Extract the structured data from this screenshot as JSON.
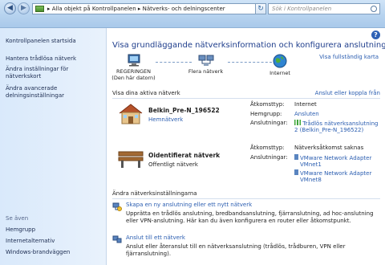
{
  "address": {
    "breadcrumb_root": "Alla objekt på Kontrollpanelen",
    "breadcrumb_current": "Nätverks- och delningscenter",
    "separator": "▸",
    "search_placeholder": "Sök i Kontrollpanelen"
  },
  "sidebar": {
    "items": [
      {
        "label": "Kontrollpanelen startsida"
      },
      {
        "label": "Hantera trådlösa nätverk"
      },
      {
        "label": "Ändra inställningar för nätverkskort"
      },
      {
        "label": "Ändra avancerade delningsinställningar"
      }
    ],
    "see_also_label": "Se även",
    "see_also": [
      {
        "label": "Hemgrupp"
      },
      {
        "label": "Internetalternativ"
      },
      {
        "label": "Windows-brandväggen"
      }
    ]
  },
  "main": {
    "title": "Visa grundläggande nätverksinformation och konfigurera anslutningar",
    "full_map_link": "Visa fullständig karta",
    "map": {
      "computer": "REGERINGEN",
      "computer_sub": "(Den här datorn)",
      "networks": "Flera nätverk",
      "internet": "Internet"
    },
    "active_networks_heading": "Visa dina aktiva nätverk",
    "connect_link": "Anslut eller koppla från",
    "networks": [
      {
        "name": "Belkin_Pre-N_196522",
        "type_link": "Hemnätverk",
        "access_label": "Åtkomsttyp:",
        "access_value": "Internet",
        "homegroup_label": "Hemgrupp:",
        "homegroup_value": "Ansluten",
        "connections_label": "Anslutningar:",
        "connections_value_line1": "Trådlös nätverksanslutning",
        "connections_value_line2": "2 (Belkin_Pre-N_196522)"
      },
      {
        "name": "Oidentifierat nätverk",
        "type_text": "Offentligt nätverk",
        "access_label": "Åtkomsttyp:",
        "access_value": "Nätverksåtkomst saknas",
        "connections_label": "Anslutningar:",
        "adapter1_line1": "VMware Network Adapter",
        "adapter1_line2": "VMnet1",
        "adapter2_line1": "VMware Network Adapter",
        "adapter2_line2": "VMnet8"
      }
    ],
    "change_settings_heading": "Ändra nätverksinställningarna",
    "tasks": [
      {
        "title": "Skapa en ny anslutning eller ett nytt nätverk",
        "desc": "Upprätta en trådlös anslutning, bredbandsanslutning, fjärranslutning, ad hoc-anslutning eller VPN-anslutning. Här kan du även konfigurera en router eller åtkomstpunkt."
      },
      {
        "title": "Anslut till ett nätverk",
        "desc": "Anslut eller återanslut till en nätverksanslutning (trådlös, trådburen, VPN eller fjärranslutning)."
      }
    ],
    "help_label": "?"
  },
  "colors": {
    "link": "#2a5db0",
    "title": "#1f3e8c",
    "sidebar_bg": "#dfecfb"
  }
}
